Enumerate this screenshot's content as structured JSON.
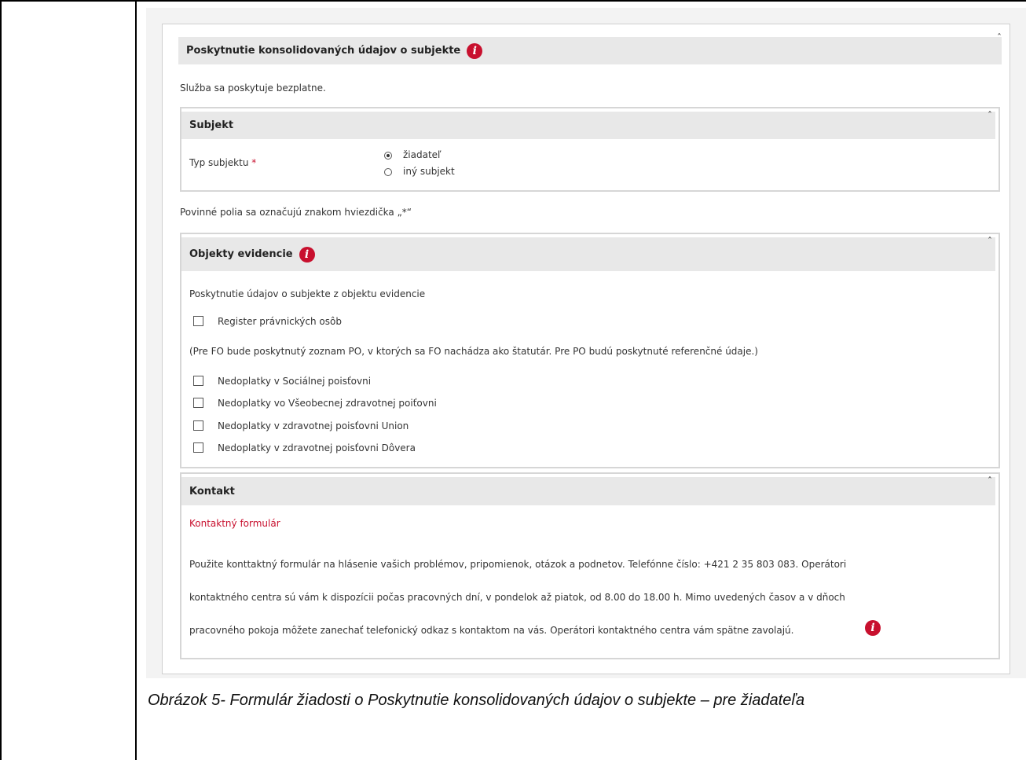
{
  "main": {
    "title": "Poskytnutie konsolidovaných údajov o subjekte",
    "fee_note": "Služba sa poskytuje bezplatne.",
    "required_note": "Povinné polia sa označujú znakom hviezdička „*“"
  },
  "subjekt": {
    "title": "Subjekt",
    "field_label": "Typ subjektu",
    "required_mark": "*",
    "options": [
      {
        "label": "žiadateľ",
        "checked": true
      },
      {
        "label": "iný subjekt",
        "checked": false
      }
    ]
  },
  "objekty": {
    "title": "Objekty evidencie",
    "intro": "Poskytnutie údajov o subjekte z objektu evidencie",
    "register_label": "Register právnických osôb",
    "register_note": "(Pre FO bude poskytnutý zoznam PO, v ktorých sa FO nachádza ako štatutár. Pre PO budú poskytnuté referenčné údaje.)",
    "checkboxes": [
      "Nedoplatky v Sociálnej poisťovni",
      "Nedoplatky vo Všeobecnej zdravotnej poiťovni",
      "Nedoplatky v zdravotnej poisťovni Union",
      "Nedoplatky v zdravotnej poisťovni Dôvera"
    ]
  },
  "kontakt": {
    "title": "Kontakt",
    "link": "Kontaktný formulár",
    "lines": [
      "Použite konttaktný formulár na hlásenie vašich problémov, pripomienok, otázok a podnetov. Telefónne číslo: +421 2 35 803 083. Operátori",
      "kontaktného centra sú vám k dispozícii počas pracovných dní, v pondelok až piatok, od 8.00 do 18.00 h. Mimo uvedených časov a v dňoch",
      "pracovného pokoja môžete zanechať telefonický odkaz s kontaktom na vás. Operátori kontaktného centra vám spätne zavolajú."
    ]
  },
  "caption": "Obrázok 5- Formulár žiadosti o Poskytnutie konsolidovaných údajov o subjekte – pre žiadateľa",
  "icons": {
    "info": "info-icon",
    "collapse": "chevron-up-icon"
  },
  "colors": {
    "accent": "#c8102e",
    "header_bg": "#e8e8e8"
  }
}
